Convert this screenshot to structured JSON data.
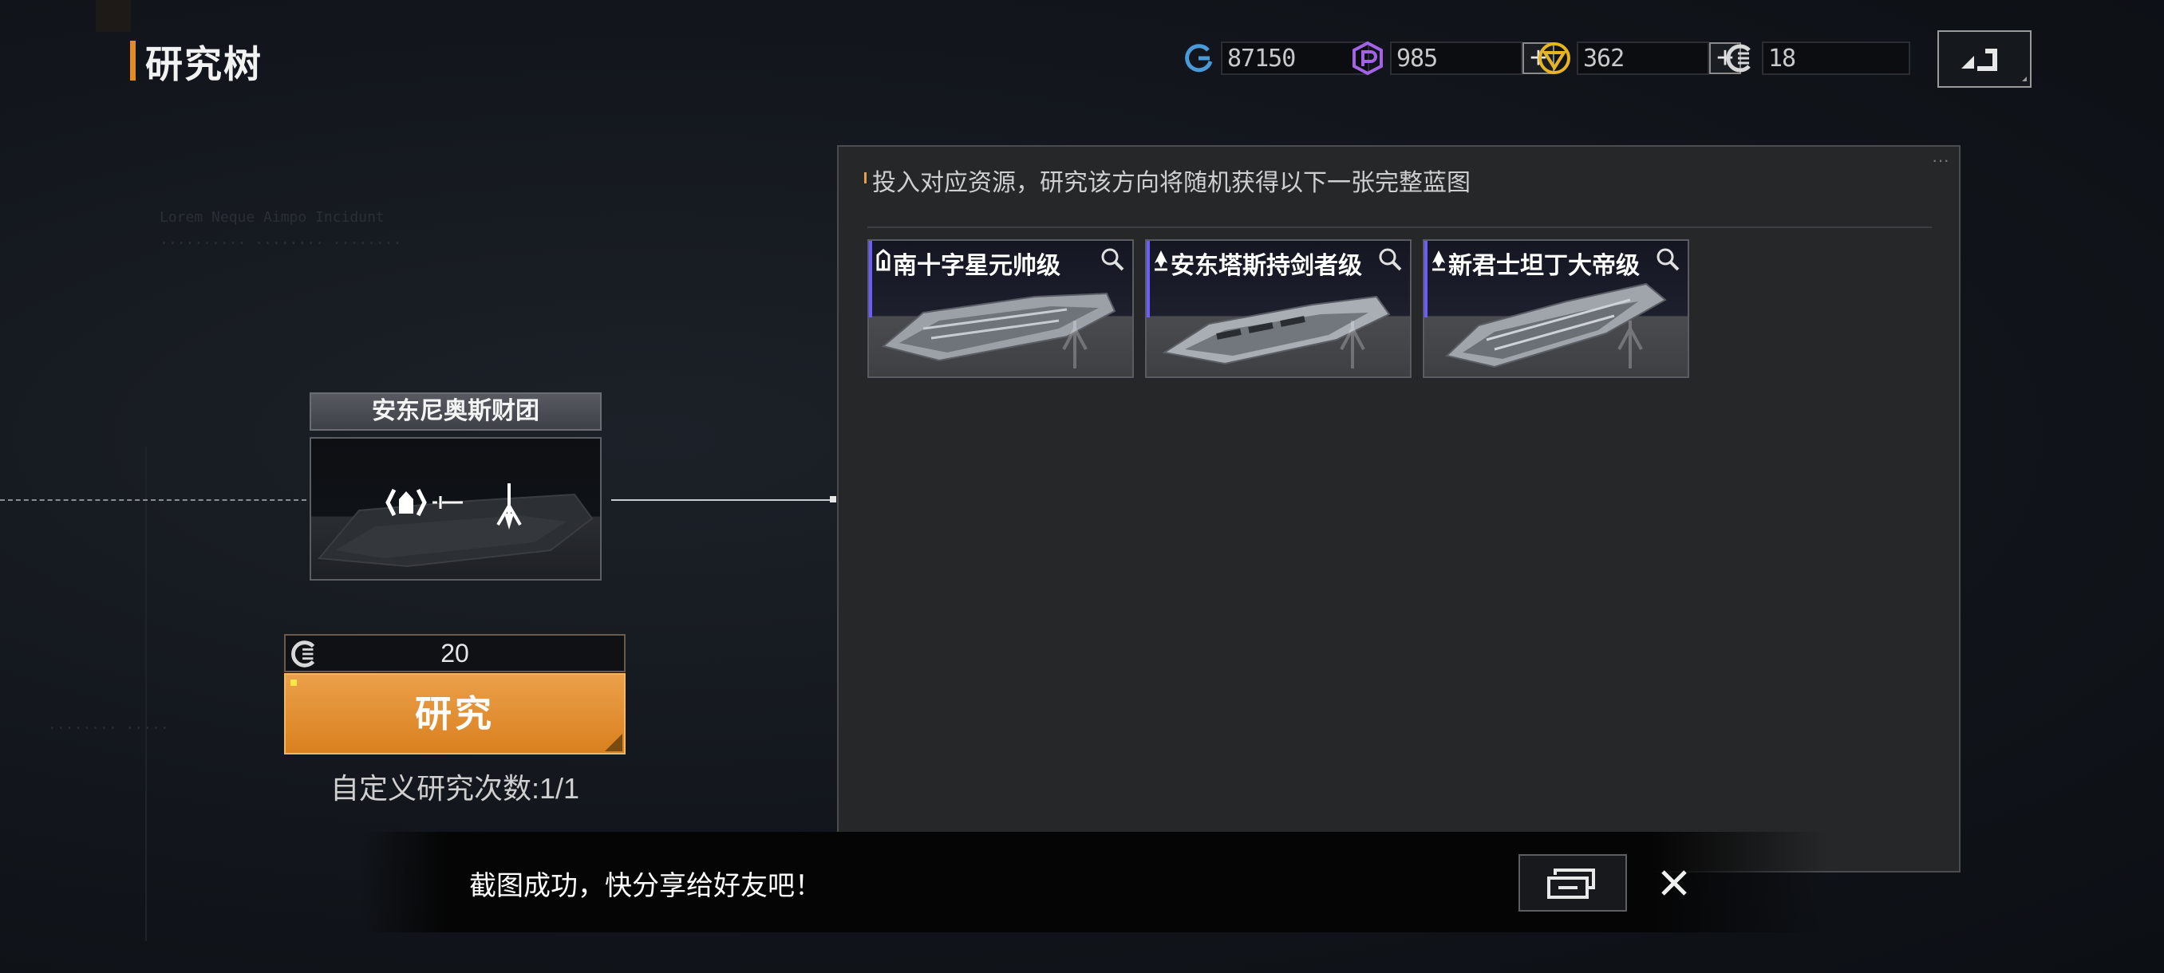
{
  "header": {
    "title": "研究树",
    "resources": [
      {
        "icon": "credit-icon",
        "value": "87150",
        "color": "#4a9ad8",
        "has_plus": false
      },
      {
        "icon": "premium-gem-icon",
        "value": "985",
        "color": "#a463e6",
        "has_plus": true
      },
      {
        "icon": "gold-coin-icon",
        "value": "362",
        "color": "#e6b521",
        "has_plus": true
      },
      {
        "icon": "research-token-icon",
        "value": "18",
        "color": "#d8d8d8",
        "has_plus": false
      }
    ],
    "plus_label": "+"
  },
  "node": {
    "name": "安东尼奥斯财团"
  },
  "research": {
    "cost": "20",
    "button_label": "研究",
    "count_text": "自定义研究次数:1/1"
  },
  "panel": {
    "tip": "投入对应资源，研究该方向将随机获得以下一张完整蓝图",
    "ships": [
      {
        "name": "南十字星元帅级",
        "type_icon": "carrier-class-icon"
      },
      {
        "name": "安东塔斯持剑者级",
        "type_icon": "battleship-class-icon"
      },
      {
        "name": "新君士坦丁大帝级",
        "type_icon": "battleship-class-icon"
      }
    ]
  },
  "toast": {
    "message": "截图成功，快分享给好友吧！"
  },
  "colors": {
    "accent_orange": "#e08a2a",
    "button_orange": "#df8a2b",
    "ship_accent": "#6b5cff"
  }
}
